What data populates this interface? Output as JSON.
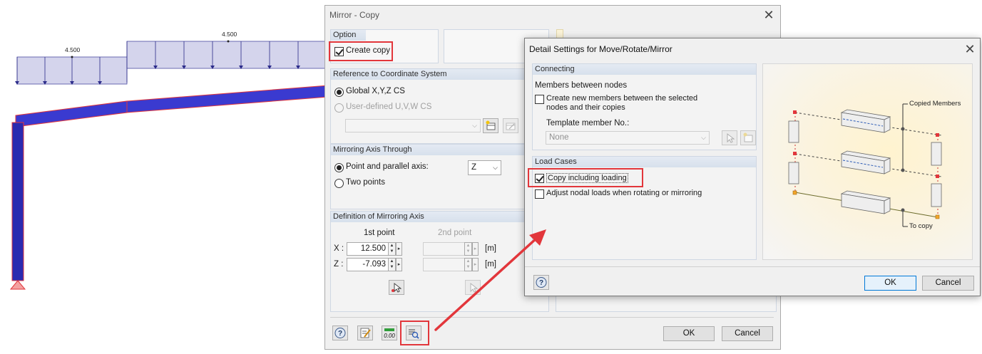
{
  "drawing": {
    "load_label_left": "4.500",
    "load_label_right": "4.500"
  },
  "mirror_dialog": {
    "title": "Mirror - Copy",
    "option": {
      "header": "Option",
      "create_copy_label": "Create copy",
      "create_copy_checked": true
    },
    "reference": {
      "header": "Reference to Coordinate System",
      "global_label": "Global X,Y,Z CS",
      "user_defined_label": "User-defined U,V,W CS",
      "selected": "global"
    },
    "axis_through": {
      "header": "Mirroring Axis Through",
      "point_parallel_label": "Point and parallel axis:",
      "two_points_label": "Two points",
      "axis_value": "Z",
      "selected": "point_parallel"
    },
    "definition": {
      "header": "Definition of Mirroring Axis",
      "first_point_header": "1st point",
      "second_point_header": "2nd point",
      "x_label": "X :",
      "z_label": "Z :",
      "x_value": "12.500",
      "z_value": "-7.093",
      "unit_x": "[m]",
      "unit_z": "[m]"
    },
    "ok_label": "OK",
    "cancel_label": "Cancel"
  },
  "detail_dialog": {
    "title": "Detail Settings for Move/Rotate/Mirror",
    "connecting": {
      "header": "Connecting",
      "members_between_nodes": "Members between nodes",
      "create_new_members_line1": "Create new members between the selected",
      "create_new_members_line2": "nodes and their copies",
      "create_new_members_checked": false,
      "template_member_label": "Template member No.:",
      "template_member_value": "None"
    },
    "load_cases": {
      "header": "Load Cases",
      "copy_including_loading_label": "Copy including loading",
      "copy_including_loading_checked": true,
      "adjust_nodal_loads_label": "Adjust nodal loads when rotating or mirroring",
      "adjust_nodal_loads_checked": false
    },
    "illustration": {
      "copied_members_label": "Copied Members",
      "to_copy_label": "To copy"
    },
    "ok_label": "OK",
    "cancel_label": "Cancel"
  },
  "colors": {
    "highlight_red": "#e2363b",
    "member_blue": "#3a3ad0",
    "load_fill": "#d4d4ec"
  },
  "icons": {
    "help": "help-icon",
    "edit": "edit-icon",
    "numeric": "numeric-icon",
    "details": "detail-settings-icon",
    "pick": "pick-node-icon",
    "new_cs": "new-cs-icon",
    "edit_cs": "edit-cs-icon"
  }
}
